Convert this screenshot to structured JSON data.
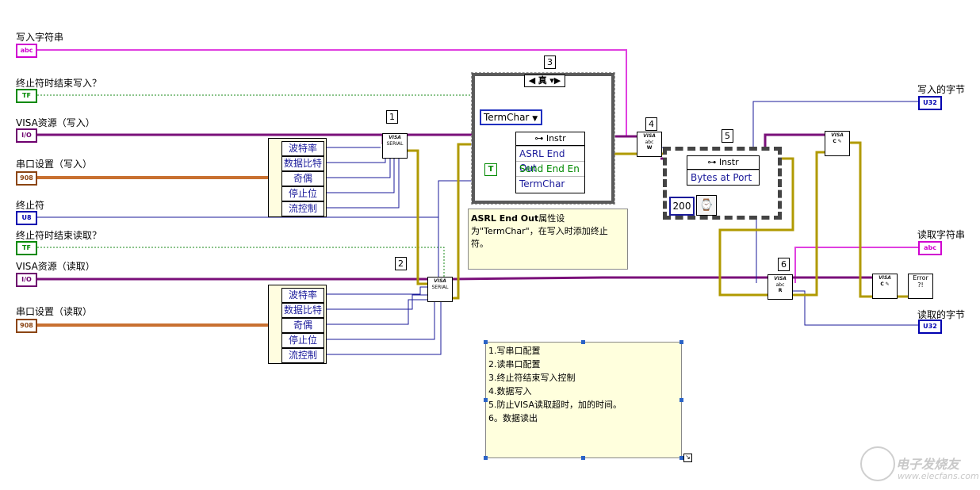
{
  "terminals": {
    "write_string": {
      "label": "写入字符串",
      "type": "abc"
    },
    "term_end_write": {
      "label": "终止符时结束写入？",
      "type": "TF"
    },
    "visa_write": {
      "label": "VISA资源（写入）",
      "type": "I/O"
    },
    "serial_write": {
      "label": "串口设置（写入）",
      "type": "908"
    },
    "term_char": {
      "label": "终止符",
      "type": "U8"
    },
    "term_end_read": {
      "label": "终止符时结束读取？",
      "type": "TF"
    },
    "visa_read": {
      "label": "VISA资源（读取）",
      "type": "I/O"
    },
    "serial_read": {
      "label": "串口设置（读取）",
      "type": "908"
    },
    "bytes_written": {
      "label": "写入的字节",
      "type": "U32"
    },
    "read_string": {
      "label": "读取字符串",
      "type": "abc"
    },
    "bytes_read": {
      "label": "读取的字节",
      "type": "U32"
    }
  },
  "step_numbers": [
    "1",
    "2",
    "3",
    "4",
    "5",
    "6"
  ],
  "serial_bundle_write": [
    "波特率",
    "数据比特",
    "奇偶",
    "停止位",
    "流控制"
  ],
  "serial_bundle_read": [
    "波特率",
    "数据比特",
    "奇偶",
    "停止位",
    "流控制"
  ],
  "visa_serial_icon": {
    "title": "VISA",
    "sub": "SERIAL"
  },
  "case_structure": {
    "selector": "真"
  },
  "termchar_ring": "TermChar",
  "true_constant": "T",
  "property_node_1": {
    "header": "Instr",
    "rows": [
      "ASRL End Out",
      "Send End En",
      "TermChar"
    ]
  },
  "property_node_2": {
    "header": "Instr",
    "rows": [
      "Bytes at Port"
    ]
  },
  "wait_constant": "200",
  "comment_3": {
    "bold": "ASRL End Out",
    "text": "属性设为\"TermChar\"，在写入时添加终止符。"
  },
  "notes": [
    "1.写串口配置",
    "2.读串口配置",
    "3.终止符结束写入控制",
    "4.数据写入",
    "5.防止VISA读取超时，加的时间。",
    "6。数据读出"
  ],
  "visa_write_icon": {
    "title": "VISA",
    "sub": "abc",
    "mode": "W"
  },
  "visa_read_icon": {
    "title": "VISA",
    "sub": "abc",
    "mode": "R"
  },
  "visa_close_icon": {
    "title": "VISA",
    "sub": "C"
  },
  "error_icon": {
    "text": "Error"
  },
  "watermark": {
    "title": "电子发烧友",
    "url": "www.elecfans.com"
  },
  "colors": {
    "string": "#d000d0",
    "boolean": "#009000",
    "visa": "#6e006e",
    "cluster": "#8b4513",
    "numeric": "#0000b0",
    "error": "#b8a000"
  }
}
